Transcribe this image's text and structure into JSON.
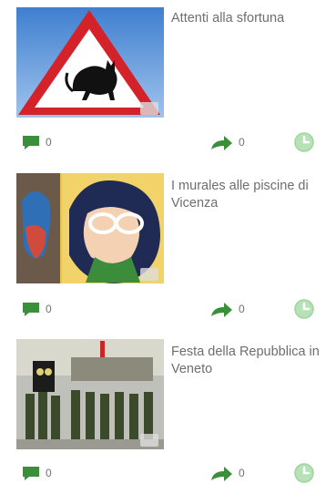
{
  "articles": [
    {
      "title": "Attenti alla sfortuna",
      "comments": "0",
      "shares": "0",
      "thumb_icon": "warning-sign-black-cat-image"
    },
    {
      "title": "I murales alle piscine di Vicenza",
      "comments": "0",
      "shares": "0",
      "thumb_icon": "mural-woman-glasses-image"
    },
    {
      "title": "Festa della Repubblica in Veneto",
      "comments": "0",
      "shares": "0",
      "thumb_icon": "military-parade-image"
    }
  ],
  "colors": {
    "comment_icon": "#3a8f3a",
    "share_icon": "#3a8f3a",
    "clock_icon": "#9fd49f",
    "text": "#6e6e6e"
  }
}
